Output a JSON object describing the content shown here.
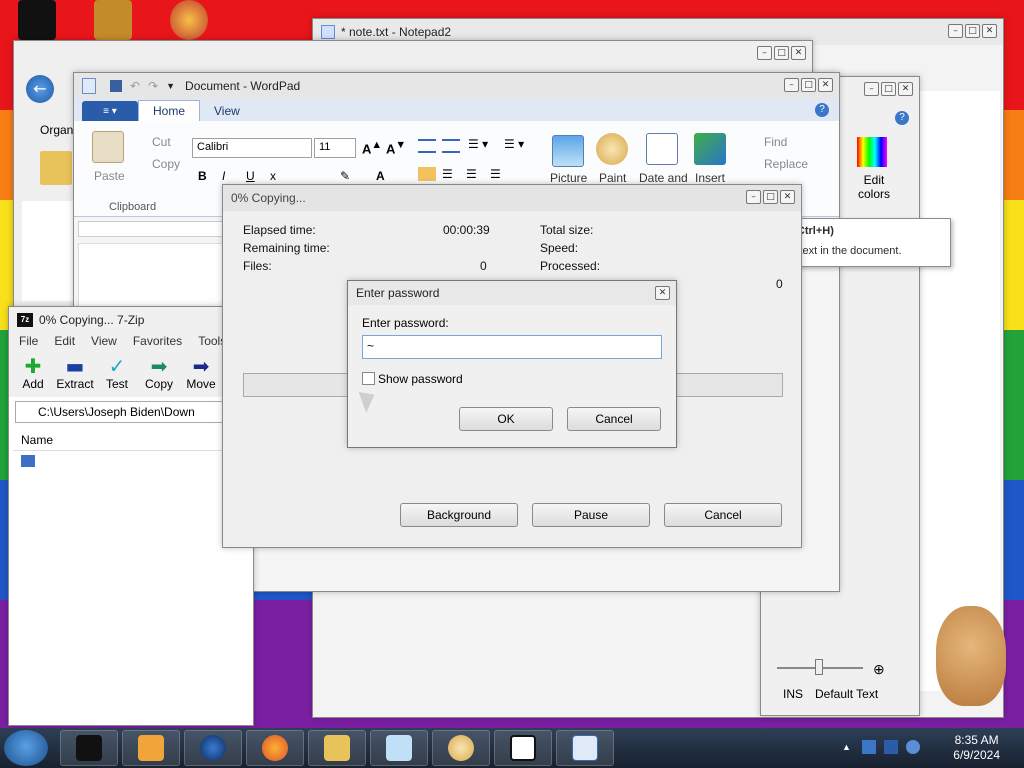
{
  "notepad": {
    "title": "* note.txt - Notepad2"
  },
  "paint": {
    "edit_colors": "Edit colors",
    "status_ins": "INS",
    "status_style": "Default Text"
  },
  "explorer": {
    "organize": "Organ"
  },
  "wordpad": {
    "title": "Document - WordPad",
    "tabs": [
      "Home",
      "View"
    ],
    "paste": "Paste",
    "cut": "Cut",
    "copy": "Copy",
    "clipboard": "Clipboard",
    "font_name": "Calibri",
    "font_size": "11",
    "picture": "Picture",
    "paint": "Paint",
    "date_time": "Date and",
    "insert": "Insert",
    "find": "Find",
    "replace": "Replace"
  },
  "tooltip": {
    "title": "Replace (Ctrl+H)",
    "description": "Replace text in the document."
  },
  "zip": {
    "title": "0% Copying... 7-Zip",
    "menu": [
      "File",
      "Edit",
      "View",
      "Favorites",
      "Tools"
    ],
    "tools": [
      "Add",
      "Extract",
      "Test",
      "Copy",
      "Move"
    ],
    "path": "C:\\Users\\Joseph Biden\\Down",
    "column_name": "Name"
  },
  "copying": {
    "title": "0% Copying...",
    "elapsed_label": "Elapsed time:",
    "elapsed_value": "00:00:39",
    "remaining_label": "Remaining time:",
    "files_label": "Files:",
    "files_value": "0",
    "total_size_label": "Total size:",
    "speed_label": "Speed:",
    "processed_label": "Processed:",
    "processed_value": "0",
    "background_btn": "Background",
    "pause_btn": "Pause",
    "cancel_btn": "Cancel"
  },
  "password": {
    "title": "Enter password",
    "label": "Enter password:",
    "value": "~",
    "show_password": "Show password",
    "ok": "OK",
    "cancel": "Cancel"
  },
  "taskbar": {
    "time": "8:35 AM",
    "date": "6/9/2024"
  },
  "colors": {
    "accent": "#2a5caa",
    "taskbar": "#1c2738"
  }
}
